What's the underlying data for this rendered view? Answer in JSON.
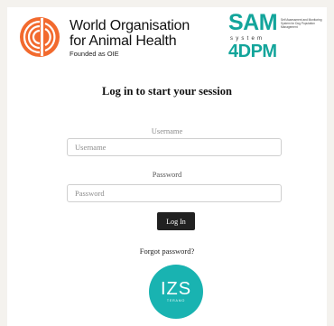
{
  "header": {
    "woah": {
      "line1": "World Organisation",
      "line2": "for Animal Health",
      "line3": "Founded as OIE"
    },
    "sam": {
      "top": "SAM",
      "system": "system",
      "bottom": "4DPM",
      "description": "Self Assessment and Monitoring System for Dog Population Management"
    }
  },
  "login": {
    "title": "Log in to start your session",
    "username_label": "Username",
    "username_placeholder": "Username",
    "username_value": "",
    "password_label": "Password",
    "password_placeholder": "Password",
    "password_value": "",
    "button_label": "Log In",
    "forgot_label": "Forgot password?"
  },
  "footer": {
    "izs_text": "IZS",
    "izs_sub": "TERAMO"
  },
  "colors": {
    "brand_teal": "#13a59b",
    "woah_orange": "#f26a2e",
    "button_dark": "#212121"
  }
}
